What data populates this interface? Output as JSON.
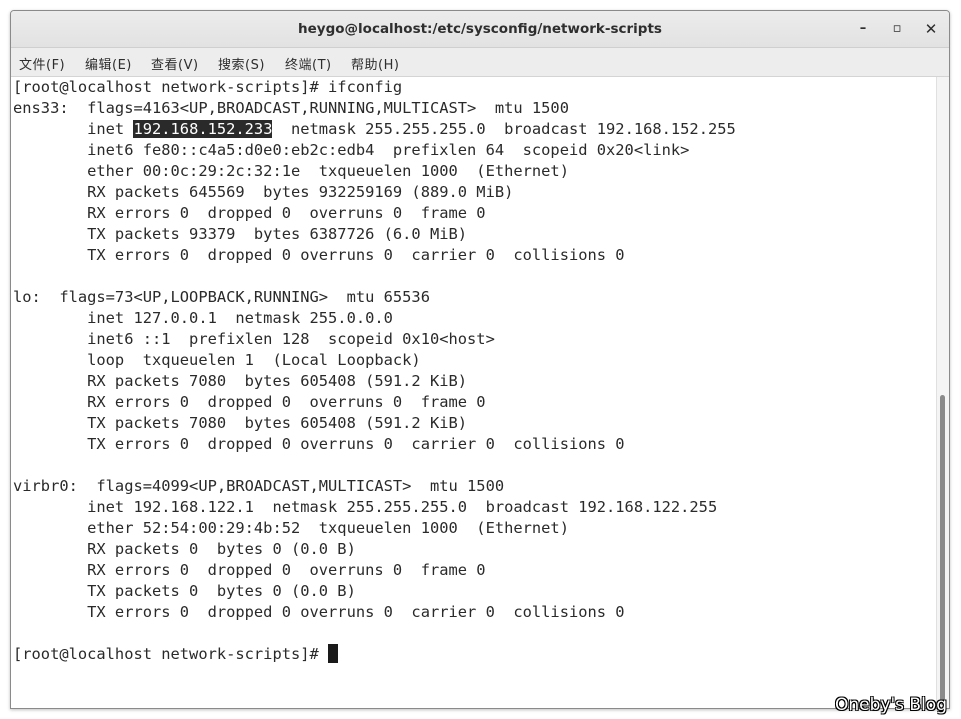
{
  "window": {
    "title": "heygo@localhost:/etc/sysconfig/network-scripts",
    "minimize": "–",
    "maximize": "▫",
    "close": "✕"
  },
  "menu": [
    "文件(F)",
    "编辑(E)",
    "查看(V)",
    "搜索(S)",
    "终端(T)",
    "帮助(H)"
  ],
  "terminal": {
    "lines": [
      "[root@localhost network-scripts]# ifconfig",
      "ens33:  flags=4163<UP,BROADCAST,RUNNING,MULTICAST>  mtu 1500",
      "        inet ",
      "        inet6 fe80::c4a5:d0e0:eb2c:edb4  prefixlen 64  scopeid 0x20<link>",
      "        ether 00:0c:29:2c:32:1e  txqueuelen 1000  (Ethernet)",
      "        RX packets 645569  bytes 932259169 (889.0 MiB)",
      "        RX errors 0  dropped 0  overruns 0  frame 0",
      "        TX packets 93379  bytes 6387726 (6.0 MiB)",
      "        TX errors 0  dropped 0 overruns 0  carrier 0  collisions 0",
      "",
      "lo:  flags=73<UP,LOOPBACK,RUNNING>  mtu 65536",
      "        inet 127.0.0.1  netmask 255.0.0.0",
      "        inet6 ::1  prefixlen 128  scopeid 0x10<host>",
      "        loop  txqueuelen 1  (Local Loopback)",
      "        RX packets 7080  bytes 605408 (591.2 KiB)",
      "        RX errors 0  dropped 0  overruns 0  frame 0",
      "        TX packets 7080  bytes 605408 (591.2 KiB)",
      "        TX errors 0  dropped 0 overruns 0  carrier 0  collisions 0",
      "",
      "virbr0:  flags=4099<UP,BROADCAST,MULTICAST>  mtu 1500",
      "        inet 192.168.122.1  netmask 255.255.255.0  broadcast 192.168.122.255",
      "        ether 52:54:00:29:4b:52  txqueuelen 1000  (Ethernet)",
      "        RX packets 0  bytes 0 (0.0 B)",
      "        RX errors 0  dropped 0  overruns 0  frame 0",
      "        TX packets 0  bytes 0 (0.0 B)",
      "        TX errors 0  dropped 0 overruns 0  carrier 0  collisions 0",
      "",
      "[root@localhost network-scripts]# "
    ],
    "selected_text": "192.168.152.233",
    "after_selection": "  netmask 255.255.255.0  broadcast 192.168.152.255"
  },
  "watermark": "Oneby's Blog"
}
